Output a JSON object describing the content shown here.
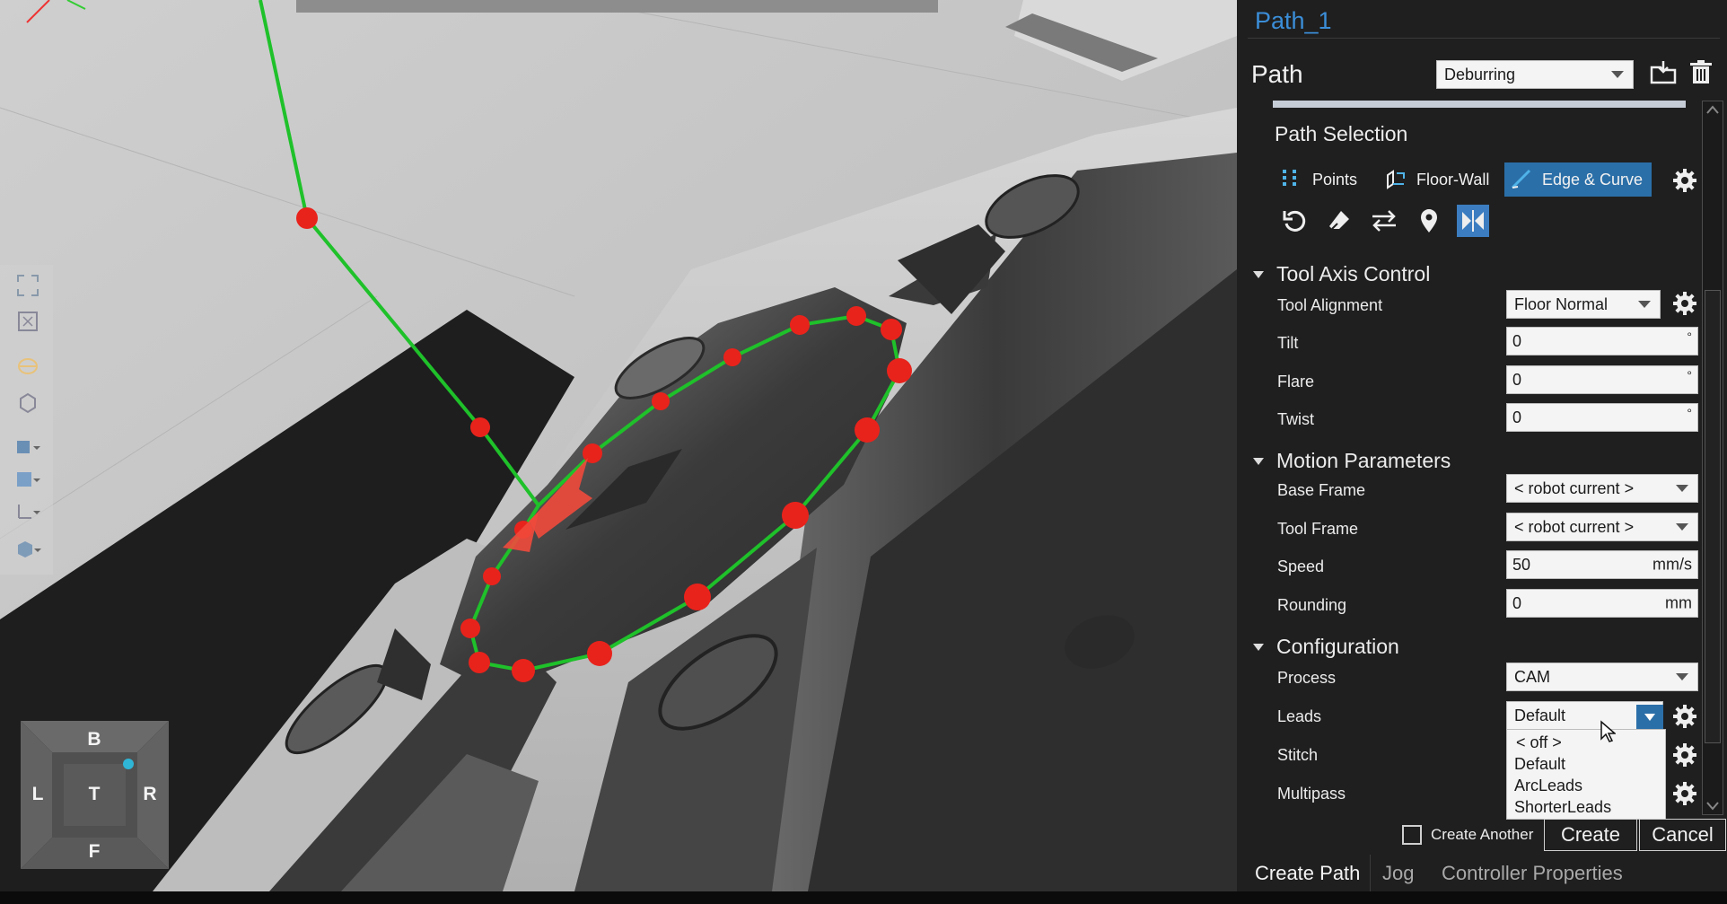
{
  "navcube": {
    "top": "B",
    "left": "L",
    "center": "T",
    "right": "R",
    "bottom": "F"
  },
  "panel": {
    "title": "Path_1",
    "path_label": "Path",
    "path_type": "Deburring",
    "path_selection_title": "Path Selection",
    "modes": [
      {
        "label": "Points"
      },
      {
        "label": "Floor-Wall"
      },
      {
        "label": "Edge & Curve",
        "active": true
      }
    ],
    "tool_axis": {
      "header": "Tool Axis Control",
      "tool_alignment_label": "Tool Alignment",
      "tool_alignment_value": "Floor Normal",
      "tilt_label": "Tilt",
      "tilt_value": "0",
      "flare_label": "Flare",
      "flare_value": "0",
      "twist_label": "Twist",
      "twist_value": "0",
      "degree_symbol": "°"
    },
    "motion": {
      "header": "Motion Parameters",
      "base_frame_label": "Base Frame",
      "base_frame_value": "< robot current >",
      "tool_frame_label": "Tool Frame",
      "tool_frame_value": "< robot current >",
      "speed_label": "Speed",
      "speed_value": "50",
      "speed_unit": "mm/s",
      "rounding_label": "Rounding",
      "rounding_value": "0",
      "rounding_unit": "mm"
    },
    "configuration": {
      "header": "Configuration",
      "process_label": "Process",
      "process_value": "CAM",
      "leads_label": "Leads",
      "leads_value": "Default",
      "leads_options": [
        "< off >",
        "Default",
        "ArcLeads",
        "ShorterLeads"
      ],
      "stitch_label": "Stitch",
      "multipass_label": "Multipass"
    },
    "create_another_label": "Create Another",
    "create_button": "Create",
    "cancel_button": "Cancel",
    "tabs": [
      "Create Path",
      "Jog",
      "Controller Properties"
    ],
    "colors": {
      "accent": "#3b8ed8",
      "active_button": "#2b6fa8",
      "path_green": "#1fc12a",
      "path_points": "#e8231c"
    }
  }
}
